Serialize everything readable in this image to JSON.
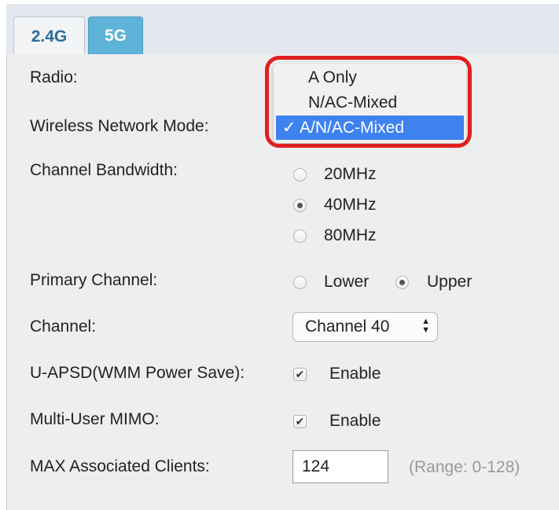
{
  "tabs": [
    {
      "label": "2.4G",
      "active": false
    },
    {
      "label": "5G",
      "active": true
    }
  ],
  "form": {
    "radio_label": "Radio:",
    "mode_label": "Wireless Network Mode:",
    "bandwidth_label": "Channel Bandwidth:",
    "bandwidth_options": [
      {
        "label": "20MHz",
        "checked": false
      },
      {
        "label": "40MHz",
        "checked": true
      },
      {
        "label": "80MHz",
        "checked": false
      }
    ],
    "primary_label": "Primary Channel:",
    "primary_options": [
      {
        "label": "Lower",
        "checked": false
      },
      {
        "label": "Upper",
        "checked": true
      }
    ],
    "channel_label": "Channel:",
    "channel_value": "Channel 40",
    "uapsd_label": "U-APSD(WMM Power Save):",
    "uapsd_check_label": "Enable",
    "uapsd_checked": true,
    "mimo_label": "Multi-User MIMO:",
    "mimo_check_label": "Enable",
    "mimo_checked": true,
    "max_clients_label": "MAX Associated Clients:",
    "max_clients_value": "124",
    "max_clients_hint": "(Range: 0-128)"
  },
  "dropdown": {
    "items": [
      {
        "label": "A Only",
        "selected": false
      },
      {
        "label": "N/AC-Mixed",
        "selected": false
      },
      {
        "label": "A/N/AC-Mixed",
        "selected": true
      }
    ],
    "check_mark": "✓"
  },
  "colors": {
    "active_tab": "#5fb3d9",
    "highlight_border": "#e0201e",
    "menu_selection": "#3d82ef"
  }
}
